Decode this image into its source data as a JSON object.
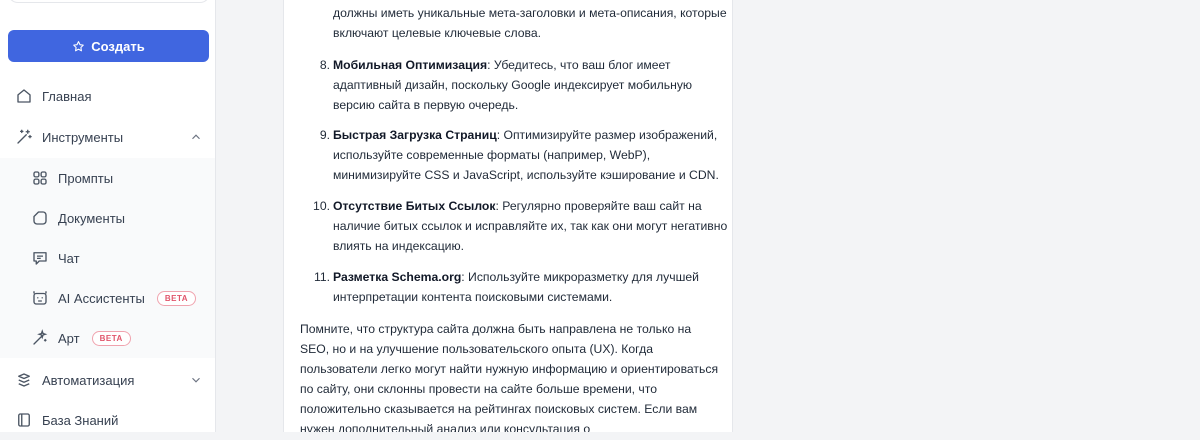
{
  "sidebar": {
    "create_label": "Создать",
    "items": [
      {
        "label": "Главная",
        "icon": "home-icon"
      },
      {
        "label": "Инструменты",
        "icon": "wand-icon"
      },
      {
        "label": "Промпты",
        "icon": "grid-icon"
      },
      {
        "label": "Документы",
        "icon": "document-icon"
      },
      {
        "label": "Чат",
        "icon": "chat-icon"
      },
      {
        "label": "AI Ассистенты",
        "icon": "robot-icon",
        "badge": "BETA"
      },
      {
        "label": "Арт",
        "icon": "magic-wand-icon",
        "badge": "BETA"
      },
      {
        "label": "Автоматизация",
        "icon": "automation-icon"
      },
      {
        "label": "База Знаний",
        "icon": "book-icon"
      }
    ]
  },
  "content": {
    "intro_tail": "должны иметь уникальные мета-заголовки и мета-описания, которые включают целевые ключевые слова.",
    "items": [
      {
        "num": "8.",
        "title": "Мобильная Оптимизация",
        "text": ": Убедитесь, что ваш блог имеет адаптивный дизайн, поскольку Google индексирует мобильную версию сайта в первую очередь."
      },
      {
        "num": "9.",
        "title": "Быстрая Загрузка Страниц",
        "text": ": Оптимизируйте размер изображений, используйте современные форматы (например, WebP), минимизируйте CSS и JavaScript, используйте кэширование и CDN."
      },
      {
        "num": "10.",
        "title": "Отсутствие Битых Ссылок",
        "text": ": Регулярно проверяйте ваш сайт на наличие битых ссылок и исправляйте их, так как они могут негативно влиять на индексацию."
      },
      {
        "num": "11.",
        "title": "Разметка Schema.org",
        "text": ": Используйте микроразметку для лучшей интерпретации контента поисковыми системами."
      }
    ],
    "closing": "Помните, что структура сайта должна быть направлена не только на SEO, но и на улучшение пользовательского опыта (UX). Когда пользователи легко могут найти нужную информацию и ориентироваться по сайту, они склонны провести на сайте больше времени, что положительно сказывается на рейтингах поисковых систем. Если вам нужен дополнительный анализ или консультация о"
  }
}
